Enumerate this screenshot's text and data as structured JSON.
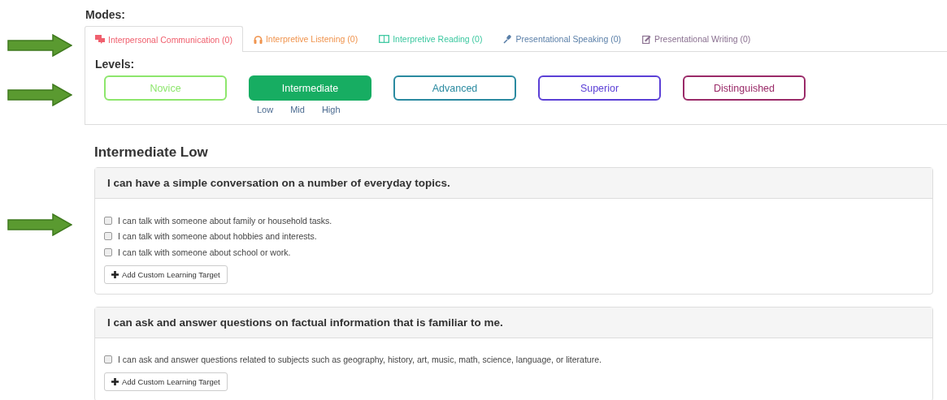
{
  "modes_label": "Modes:",
  "tabs": [
    {
      "label": "Interpersonal Communication (0)",
      "kind": "chat",
      "color": "#f0606e",
      "selected": true
    },
    {
      "label": "Interpretive Listening (0)",
      "kind": "headphones",
      "color": "#f0944e",
      "selected": false
    },
    {
      "label": "Interpretive Reading (0)",
      "kind": "book",
      "color": "#3cc8a0",
      "selected": false
    },
    {
      "label": "Presentational Speaking (0)",
      "kind": "microphone",
      "color": "#5a7fa8",
      "selected": false
    },
    {
      "label": "Presentational Writing (0)",
      "kind": "pencil",
      "color": "#8a7090",
      "selected": false
    }
  ],
  "levels_label": "Levels:",
  "levels": [
    {
      "label": "Novice",
      "color": "#8de66c",
      "selected": false
    },
    {
      "label": "Intermediate",
      "color": "#17ad62",
      "selected": true,
      "sublevels": [
        "Low",
        "Mid",
        "High"
      ]
    },
    {
      "label": "Advanced",
      "color": "#2a8aa0",
      "selected": false
    },
    {
      "label": "Superior",
      "color": "#5b3fd6",
      "selected": false
    },
    {
      "label": "Distinguished",
      "color": "#9a2a68",
      "selected": false
    }
  ],
  "heading": "Intermediate Low",
  "groups": [
    {
      "title": "I can have a simple conversation on a number of everyday topics.",
      "targets": [
        {
          "text": "I can talk with someone about family or household tasks.",
          "checked": false
        },
        {
          "text": "I can talk with someone about hobbies and interests.",
          "checked": false
        },
        {
          "text": "I can talk with someone about school or work.",
          "checked": false
        }
      ],
      "button": "Add Custom Learning Target"
    },
    {
      "title": "I can ask and answer questions on factual information that is familiar to me.",
      "targets": [
        {
          "text": "I can ask and answer questions related to subjects such as geography, history, art, music, math, science, language, or literature.",
          "checked": false
        }
      ],
      "button": "Add Custom Learning Target"
    }
  ]
}
